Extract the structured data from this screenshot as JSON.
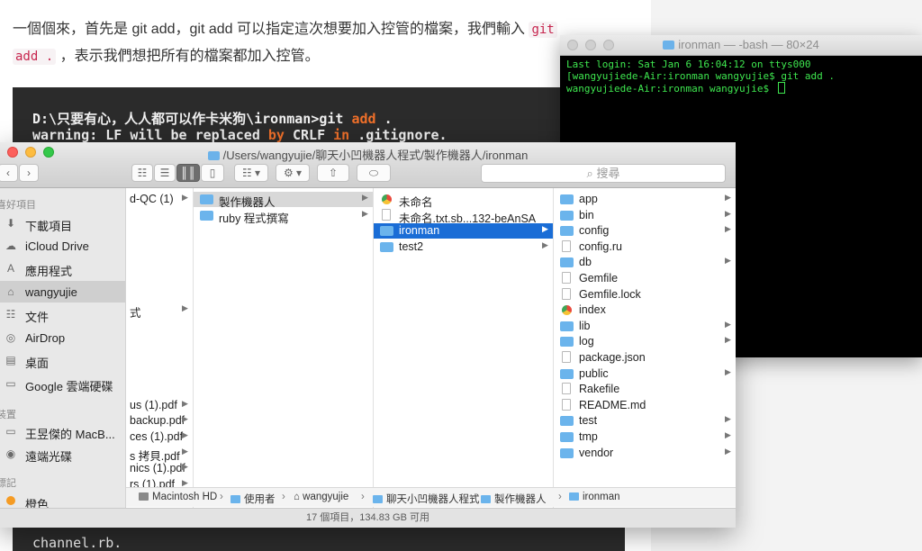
{
  "article": {
    "line1": "一個個來，首先是 git add，git add 可以指定這次想要加入控管的檔案，我們輸入",
    "line1_code": "git",
    "line2_code": "add .",
    "line2": "，表示我們想把所有的檔案都加入控管。",
    "code_prompt": "D:\\只要有心，人人都可以作卡米狗\\ironman>git ",
    "code_kw_add": "add",
    "code_dot": " .",
    "warning_a": "warning: LF will be replaced ",
    "warning_by": "by",
    "warning_b": " CRLF ",
    "warning_in": "in",
    "warning_c": " .gitignore.",
    "bottom_code": "channel.rb."
  },
  "terminal": {
    "title": "ironman — -bash — 80×24",
    "lines": [
      "Last login: Sat Jan  6 16:04:12 on ttys000",
      "[wangyujiede-Air:ironman wangyujie$ git add .",
      " wangyujiede-Air:ironman wangyujie$ "
    ]
  },
  "finder": {
    "title": "/Users/wangyujie/聊天小凹機器人程式/製作機器人/ironman",
    "search_placeholder": "搜尋",
    "sidebar": {
      "favorites_header": "喜好項目",
      "devices_header": "裝置",
      "tags_header": "標記",
      "items": [
        {
          "label": "下載項目",
          "icon": "download-icon"
        },
        {
          "label": "iCloud Drive",
          "icon": "cloud-icon"
        },
        {
          "label": "應用程式",
          "icon": "applications-icon"
        },
        {
          "label": "wangyujie",
          "icon": "home-icon"
        },
        {
          "label": "文件",
          "icon": "document-icon"
        },
        {
          "label": "AirDrop",
          "icon": "airdrop-icon"
        },
        {
          "label": "桌面",
          "icon": "desktop-icon"
        },
        {
          "label": "Google 雲端硬碟",
          "icon": "folder-icon"
        }
      ],
      "devices": [
        {
          "label": "王昱傑的 MacB...",
          "icon": "laptop-icon"
        },
        {
          "label": "遠端光碟",
          "icon": "disc-icon"
        }
      ],
      "tags": [
        {
          "label": "橙色",
          "color": "#f59b23"
        }
      ]
    },
    "col1": [
      {
        "label": "d-QC (1)",
        "y": 0
      },
      {
        "label": "式",
        "y": 7
      },
      {
        "label": "us (1).pdf",
        "y": 13
      },
      {
        "label": "backup.pdf",
        "y": 14
      },
      {
        "label": "ces (1).pdf",
        "y": 15
      },
      {
        "label": "s 拷貝.pdf",
        "y": 16
      },
      {
        "label": "nics (1).pdf",
        "y": 17
      },
      {
        "label": "rs (1).pdf",
        "y": 18
      }
    ],
    "col2": [
      {
        "label": "製作機器人",
        "selected": true
      },
      {
        "label": "ruby 程式撰寫",
        "selected": false
      }
    ],
    "col3": [
      {
        "label": "未命名",
        "kind": "chrome"
      },
      {
        "label": "未命名.txt.sb...132-beAnSA",
        "kind": "doc"
      },
      {
        "label": "ironman",
        "kind": "folder",
        "selected": true
      },
      {
        "label": "test2",
        "kind": "folder"
      }
    ],
    "col4": [
      {
        "label": "app",
        "kind": "folder",
        "chev": true
      },
      {
        "label": "bin",
        "kind": "folder",
        "chev": true
      },
      {
        "label": "config",
        "kind": "folder",
        "chev": true
      },
      {
        "label": "config.ru",
        "kind": "doc",
        "chev": false
      },
      {
        "label": "db",
        "kind": "folder",
        "chev": true
      },
      {
        "label": "Gemfile",
        "kind": "doc",
        "chev": false
      },
      {
        "label": "Gemfile.lock",
        "kind": "doc",
        "chev": false
      },
      {
        "label": "index",
        "kind": "chrome",
        "chev": false
      },
      {
        "label": "lib",
        "kind": "folder",
        "chev": true
      },
      {
        "label": "log",
        "kind": "folder",
        "chev": true
      },
      {
        "label": "package.json",
        "kind": "doc",
        "chev": false
      },
      {
        "label": "public",
        "kind": "folder",
        "chev": true
      },
      {
        "label": "Rakefile",
        "kind": "doc",
        "chev": false
      },
      {
        "label": "README.md",
        "kind": "doc",
        "chev": false
      },
      {
        "label": "test",
        "kind": "folder",
        "chev": true
      },
      {
        "label": "tmp",
        "kind": "folder",
        "chev": true
      },
      {
        "label": "vendor",
        "kind": "folder",
        "chev": true
      }
    ],
    "path": [
      "Macintosh HD",
      "使用者",
      "wangyujie",
      "聊天小凹機器人程式",
      "製作機器人",
      "ironman"
    ],
    "status": "17 個項目，134.83 GB 可用"
  }
}
